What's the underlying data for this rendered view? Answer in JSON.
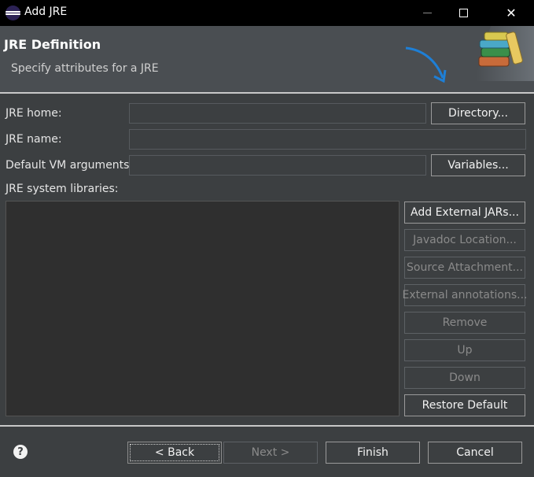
{
  "window": {
    "title": "Add JRE"
  },
  "banner": {
    "title": "JRE Definition",
    "subtitle": "Specify attributes for a JRE"
  },
  "form": {
    "jre_home_label": "JRE home:",
    "jre_home_value": "",
    "directory_button": "Directory...",
    "jre_name_label": "JRE name:",
    "jre_name_value": "",
    "vm_args_label": "Default VM arguments:",
    "vm_args_value": "",
    "variables_button": "Variables...",
    "libraries_label": "JRE system libraries:"
  },
  "library_buttons": {
    "add_external": "Add External JARs...",
    "javadoc": "Javadoc Location...",
    "source": "Source Attachment...",
    "annotations": "External annotations...",
    "remove": "Remove",
    "up": "Up",
    "down": "Down",
    "restore": "Restore Default"
  },
  "footer": {
    "help": "?",
    "back": "< Back",
    "next": "Next >",
    "finish": "Finish",
    "cancel": "Cancel"
  },
  "colors": {
    "background": "#3c3f41",
    "titlebar": "#000000",
    "banner": "#4a4e52",
    "list": "#2f2f2f",
    "arrow": "#1e7fd6"
  },
  "icons": {
    "app": "eclipse-icon",
    "banner_art": "books-jar-icon",
    "help": "help-icon"
  }
}
